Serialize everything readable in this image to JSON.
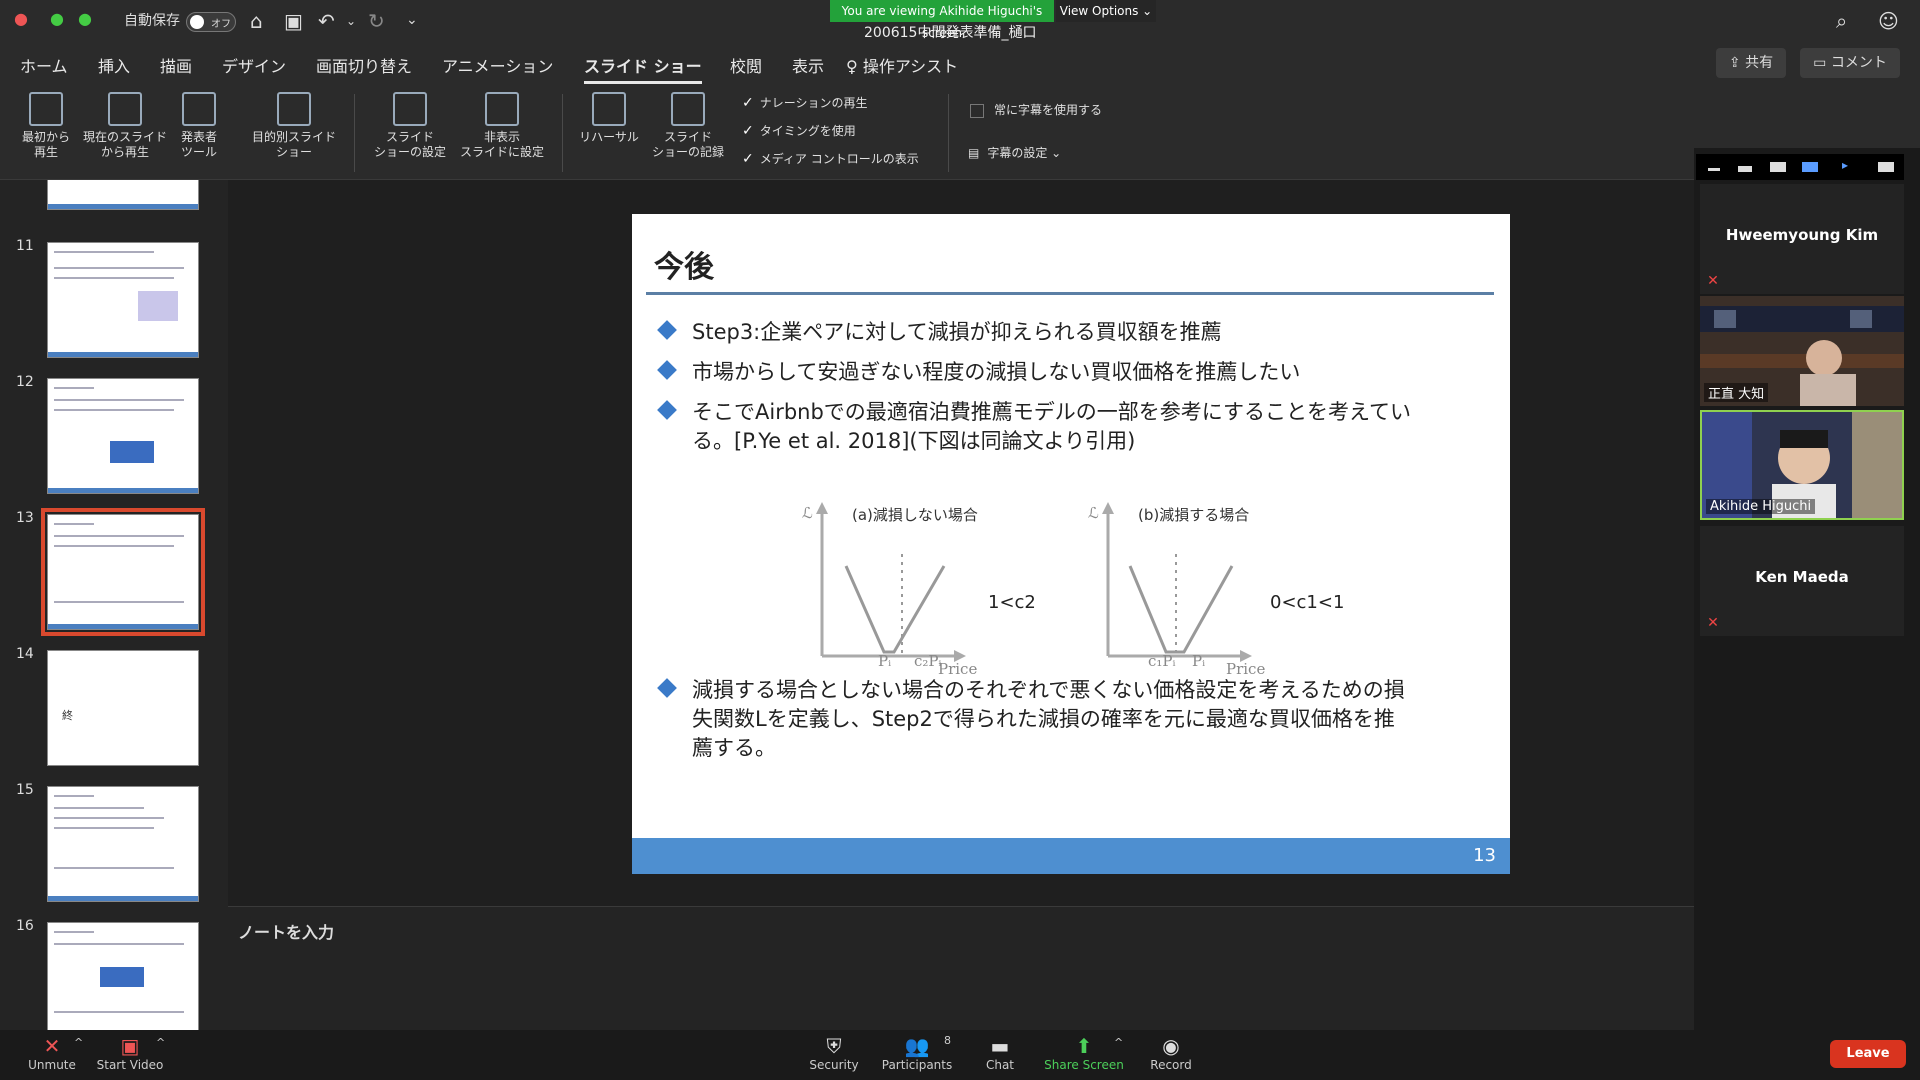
{
  "titlebar": {
    "autosave_label": "自動保存",
    "autosave_state": "オフ",
    "viewing_banner": "You are viewing Akihide Higuchi's screen",
    "view_options": "View Options",
    "document_title": "200615中間発表準備_樋口"
  },
  "ribbon_tabs": [
    "ホーム",
    "挿入",
    "描画",
    "デザイン",
    "画面切り替え",
    "アニメーション",
    "スライド ショー",
    "校閲",
    "表示",
    "操作アシスト"
  ],
  "active_tab": "スライド ショー",
  "share_label": "共有",
  "comment_label": "コメント",
  "ribbon": {
    "from_beginning": "最初から\n再生",
    "from_current": "現在のスライド\nから再生",
    "presenter_tools": "発表者\nツール",
    "custom_show": "目的別スライド\nショー",
    "show_settings": "スライド\nショーの設定",
    "hide_slide": "非表示\nスライドに設定",
    "rehearse": "リハーサル",
    "record": "スライド\nショーの記録",
    "check_narration": "ナレーションの再生",
    "check_timing": "タイミングを使用",
    "check_media": "メディア コントロールの表示",
    "always_subtitles": "常に字幕を使用する",
    "subtitle_settings": "字幕の設定"
  },
  "thumbnails": {
    "numbers": [
      "11",
      "12",
      "13",
      "14",
      "15",
      "16"
    ],
    "selected": "13",
    "slide14_text": "終"
  },
  "slide": {
    "title": "今後",
    "bullets": [
      "Step3:企業ペアに対して減損が抑えられる買収額を推薦",
      "市場からして安過ぎない程度の減損しない買収価格を推薦したい",
      "そこでAirbnbでの最適宿泊費推薦モデルの一部を参考にすることを考えている。[P.Ye et al. 2018](下図は同論文より引用)",
      "減損する場合としない場合のそれぞれで悪くない価格設定を考えるための損失関数Lを定義し、Step2で得られた減損の確率を元に最適な買収価格を推薦する。"
    ],
    "figure": {
      "panel_a_label": "(a)減損しない場合",
      "panel_b_label": "(b)減損する場合",
      "y_symbol": "ℒ",
      "x_axis": "Price",
      "a_ticks": [
        "Pᵢ",
        "c₂Pᵢ"
      ],
      "b_ticks": [
        "c₁Pᵢ",
        "Pᵢ"
      ],
      "a_condition": "1<c2",
      "b_condition": "0<c1<1"
    },
    "page_number": "13"
  },
  "notes_placeholder": "ノートを入力",
  "participants": {
    "p1": "Hweemyoung Kim",
    "p2": "正直 大知",
    "p3": "Akihide Higuchi",
    "p4": "Ken Maeda"
  },
  "toolbar": {
    "unmute": "Unmute",
    "start_video": "Start Video",
    "security": "Security",
    "participants": "Participants",
    "participants_count": "8",
    "chat": "Chat",
    "share_screen": "Share Screen",
    "record": "Record",
    "leave": "Leave"
  },
  "colors": {
    "accent_blue": "#4e8fd0",
    "bullet_blue": "#3a7ac8",
    "leave_red": "#d9341f",
    "share_green": "#23a23a",
    "selected_outline": "#d9492e"
  }
}
